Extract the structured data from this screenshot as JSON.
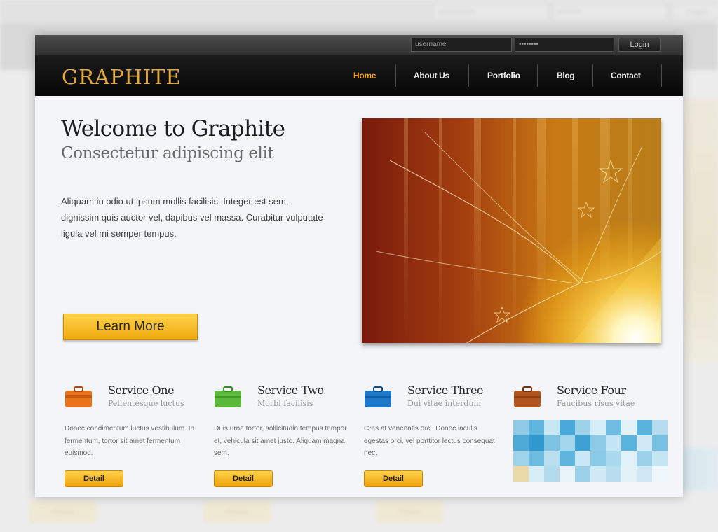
{
  "backdrop": {
    "username": "username",
    "password": "••••••••",
    "login": "Login",
    "detail_buttons": [
      "Detail",
      "Detail",
      "Detail"
    ]
  },
  "topbar": {
    "username_value": "username",
    "password_value": "••••••••",
    "login_label": "Login"
  },
  "brand": {
    "logo": "GRAPHITE",
    "color": "#e0a93a"
  },
  "nav": {
    "items": [
      "Home",
      "About Us",
      "Portfolio",
      "Blog",
      "Contact"
    ],
    "active": "Home",
    "active_color": "#f3a21b"
  },
  "hero": {
    "title": "Welcome to Graphite",
    "subtitle": "Consectetur adipiscing elit",
    "body": "Aliquam in odio ut ipsum mollis facilisis. Integer est sem, dignissim quis auctor vel, dapibus vel massa. Curabitur vulputate ligula vel mi semper tempus.",
    "cta": "Learn More"
  },
  "services": [
    {
      "title": "Service One",
      "subtitle": "Pellentesque luctus",
      "body": "Donec condimentum luctus vestibulum. In fermentum, tortor sit amet fermentum euismod.",
      "button": "Detail",
      "icon": "orange-suitcase-icon",
      "color": "#e8731c"
    },
    {
      "title": "Service Two",
      "subtitle": "Morbi facilisis",
      "body": "Duis urna tortor, sollicitudin tempus tempor et, vehicula sit amet justo. Aliquam magna sem.",
      "button": "Detail",
      "icon": "green-briefcase-icon",
      "color": "#5cb83a"
    },
    {
      "title": "Service Three",
      "subtitle": "Dui vitae interdum",
      "body": "Cras at venenatis orci. Donec iaculis egestas orci, vel porttitor lectus consequat nec.",
      "button": "Detail",
      "icon": "blue-briefcase-icon",
      "color": "#1e78c8"
    },
    {
      "title": "Service Four",
      "subtitle": "Faucibus risus vitae",
      "body": "",
      "button": "",
      "icon": "brown-briefcase-icon",
      "color": "#b0551e"
    }
  ]
}
